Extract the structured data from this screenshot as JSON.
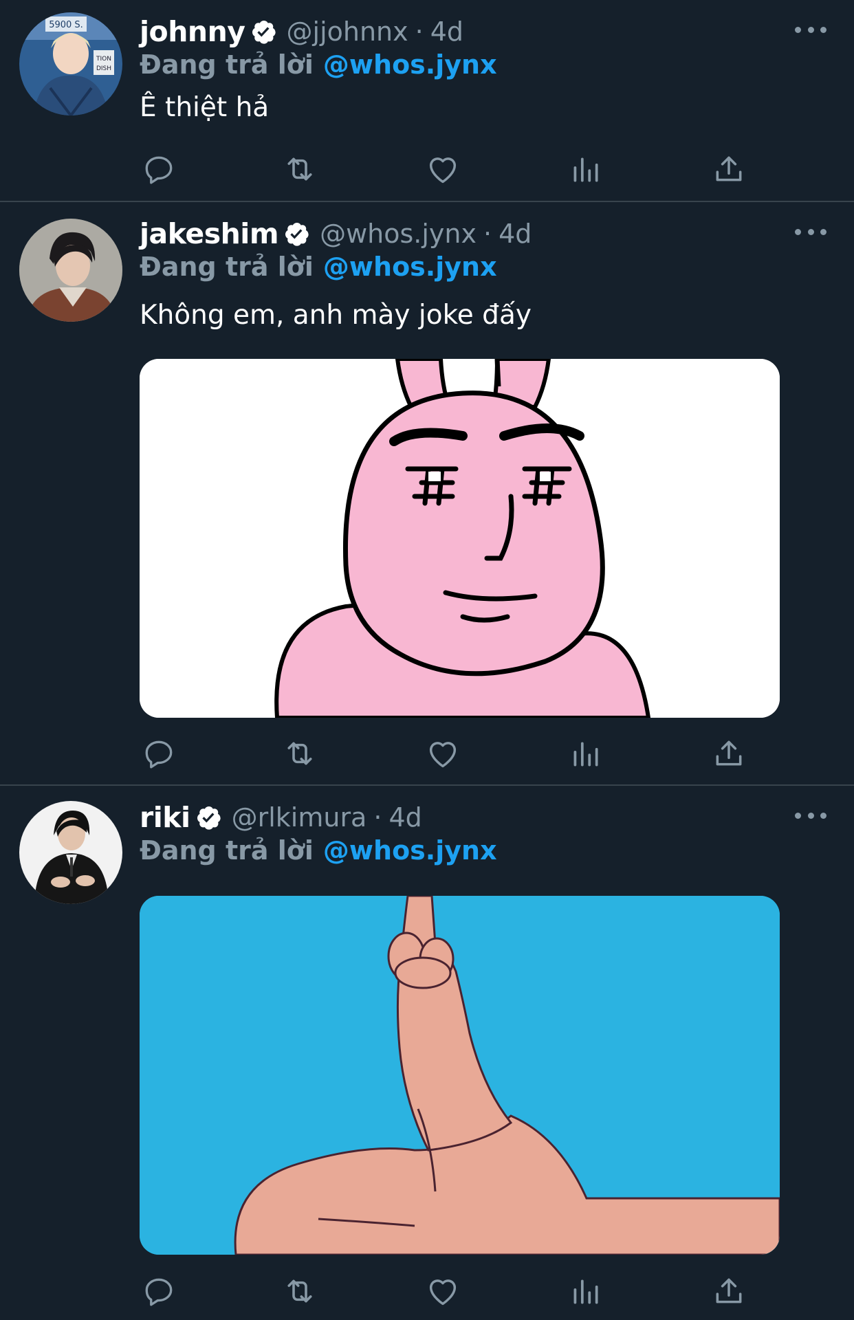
{
  "tweets": [
    {
      "name": "johnny",
      "handle": "@jjohnnx",
      "separator": "·",
      "time": "4d",
      "reply_prefix": "Đang trả lời",
      "reply_target": "@whos.jynx",
      "text": "Ê thiệt hả",
      "verified": true,
      "media": null,
      "avatar_sign_text": [
        "5900 S.",
        "TION",
        "DISH"
      ]
    },
    {
      "name": "jakeshim",
      "handle": "@whos.jynx",
      "separator": "·",
      "time": "4d",
      "reply_prefix": "Đang trả lời",
      "reply_target": "@whos.jynx",
      "text": "Không em, anh mày joke đấy",
      "verified": true,
      "media": "pink-cartoon-face"
    },
    {
      "name": "riki",
      "handle": "@rlkimura",
      "separator": "·",
      "time": "4d",
      "reply_prefix": "Đang trả lời",
      "reply_target": "@whos.jynx",
      "text": "",
      "verified": true,
      "media": "cartoon-hand-middle-finger"
    }
  ],
  "action_icons": [
    "reply-icon",
    "retweet-icon",
    "like-icon",
    "analytics-icon",
    "share-icon"
  ],
  "colors": {
    "background": "#15202b",
    "divider": "#38444d",
    "secondary_text": "#8899a6",
    "accent": "#1da1f2",
    "primary_text": "#ffffff",
    "pink_face": "#f8b7d2",
    "sky_blue": "#2bb3e1",
    "skin": "#e8a996"
  }
}
